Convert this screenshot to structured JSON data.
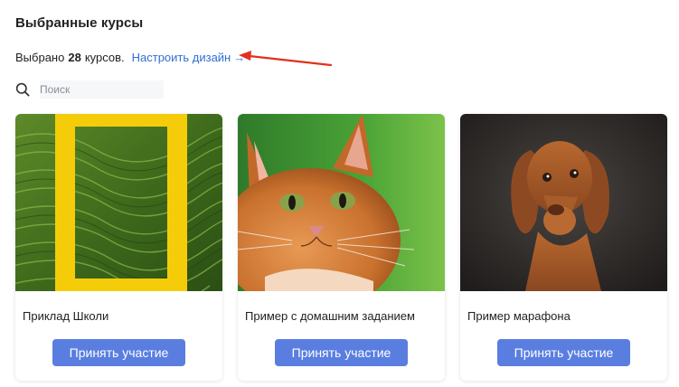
{
  "page": {
    "title": "Выбранные курсы",
    "selected_prefix": "Выбрано",
    "selected_count": "28",
    "selected_suffix": "курсов.",
    "customize_link": "Настроить дизайн",
    "customize_arrow": "→"
  },
  "search": {
    "placeholder": "Поиск",
    "value": ""
  },
  "colors": {
    "accent": "#5a7ee0",
    "link": "#2f6fd3",
    "annotation": "#e0321e"
  },
  "courses": [
    {
      "title": "Приклад Школи",
      "button_label": "Принять участие",
      "image": "national-geographic-terraces"
    },
    {
      "title": "Пример с домашним заданием",
      "button_label": "Принять участие",
      "image": "ginger-cat"
    },
    {
      "title": "Пример марафона",
      "button_label": "Принять участие",
      "image": "vizsla-dog"
    }
  ]
}
